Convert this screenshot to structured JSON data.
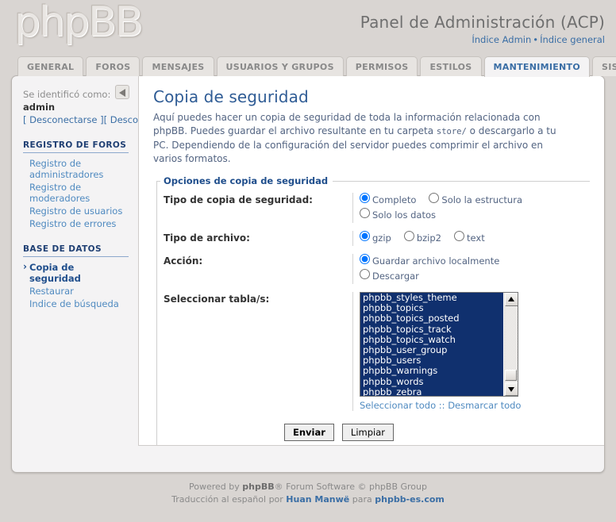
{
  "header": {
    "logo_text": "phpBB",
    "acp_title": "Panel de Administración (ACP)",
    "link_admin_index": "Índice Admin",
    "link_separator": "•",
    "link_general_index": "Índice general"
  },
  "tabs": [
    {
      "label": "GENERAL",
      "active": false
    },
    {
      "label": "FOROS",
      "active": false
    },
    {
      "label": "MENSAJES",
      "active": false
    },
    {
      "label": "USUARIOS Y GRUPOS",
      "active": false
    },
    {
      "label": "PERMISOS",
      "active": false
    },
    {
      "label": "ESTILOS",
      "active": false
    },
    {
      "label": "MANTENIMIENTO",
      "active": true
    },
    {
      "label": "SISTEMA",
      "active": false
    }
  ],
  "sidebar": {
    "identified_label": "Se identificó como:",
    "username": "admin",
    "logout_links": "[ Desconectarse ][ Desconectarse del ACP ]",
    "collapse_icon": "triangle-left-icon",
    "sections": [
      {
        "heading": "REGISTRO DE FOROS",
        "items": [
          {
            "label": "Registro de administradores",
            "active": false
          },
          {
            "label": "Registro de moderadores",
            "active": false
          },
          {
            "label": "Registro de usuarios",
            "active": false
          },
          {
            "label": "Registro de errores",
            "active": false
          }
        ]
      },
      {
        "heading": "BASE DE DATOS",
        "items": [
          {
            "label": "Copia de seguridad",
            "active": true
          },
          {
            "label": "Restaurar",
            "active": false
          },
          {
            "label": "Indice de búsqueda",
            "active": false
          }
        ]
      }
    ]
  },
  "main": {
    "title": "Copia de seguridad",
    "description_part1": "Aquí puedes hacer un copia de seguridad de toda la información relacionada con phpBB. Puedes guardar el archivo resultante en tu carpeta ",
    "description_code": "store/",
    "description_part2": " o descargarlo a tu PC. Dependiendo de la configuración del servidor puedes comprimir el archivo en varios formatos.",
    "fieldset_legend": "Opciones de copia de seguridad",
    "rows": {
      "backup_type": {
        "label": "Tipo de copia de seguridad:",
        "options": [
          {
            "label": "Completo",
            "checked": true
          },
          {
            "label": "Solo la estructura",
            "checked": false
          },
          {
            "label": "Solo los datos",
            "checked": false
          }
        ]
      },
      "file_type": {
        "label": "Tipo de archivo:",
        "options": [
          {
            "label": "gzip",
            "checked": true
          },
          {
            "label": "bzip2",
            "checked": false
          },
          {
            "label": "text",
            "checked": false
          }
        ]
      },
      "action": {
        "label": "Acción:",
        "options": [
          {
            "label": "Guardar archivo localmente",
            "checked": true
          },
          {
            "label": "Descargar",
            "checked": false
          }
        ]
      },
      "tables": {
        "label": "Seleccionar tabla/s:",
        "visible_options": [
          {
            "name": "phpbb_styles_theme",
            "selected": true
          },
          {
            "name": "phpbb_topics",
            "selected": true
          },
          {
            "name": "phpbb_topics_posted",
            "selected": true
          },
          {
            "name": "phpbb_topics_track",
            "selected": true
          },
          {
            "name": "phpbb_topics_watch",
            "selected": true
          },
          {
            "name": "phpbb_user_group",
            "selected": true
          },
          {
            "name": "phpbb_users",
            "selected": true
          },
          {
            "name": "phpbb_warnings",
            "selected": true
          },
          {
            "name": "phpbb_words",
            "selected": true
          },
          {
            "name": "phpbb_zebra",
            "selected": true
          }
        ],
        "select_all": "Seleccionar todo",
        "links_separator": "::",
        "deselect_all": "Desmarcar todo",
        "scroll_up_icon": "triangle-up-icon",
        "scroll_down_icon": "triangle-down-icon"
      }
    },
    "submit_label": "Enviar",
    "reset_label": "Limpiar"
  },
  "footer": {
    "powered_prefix": "Powered by ",
    "powered_brand": "phpBB",
    "powered_suffix": "® Forum Software © phpBB Group",
    "translation_prefix": "Traducción al español por ",
    "translator": "Huan Manwë",
    "translation_mid": " para ",
    "translation_site": "phpbb-es.com"
  },
  "colors": {
    "page_bg": "#d9d5d2",
    "panel_bg": "#f4f3f4",
    "accent_blue": "#3a6ea5",
    "title_blue": "#2f5c95",
    "select_blue": "#10306e"
  }
}
